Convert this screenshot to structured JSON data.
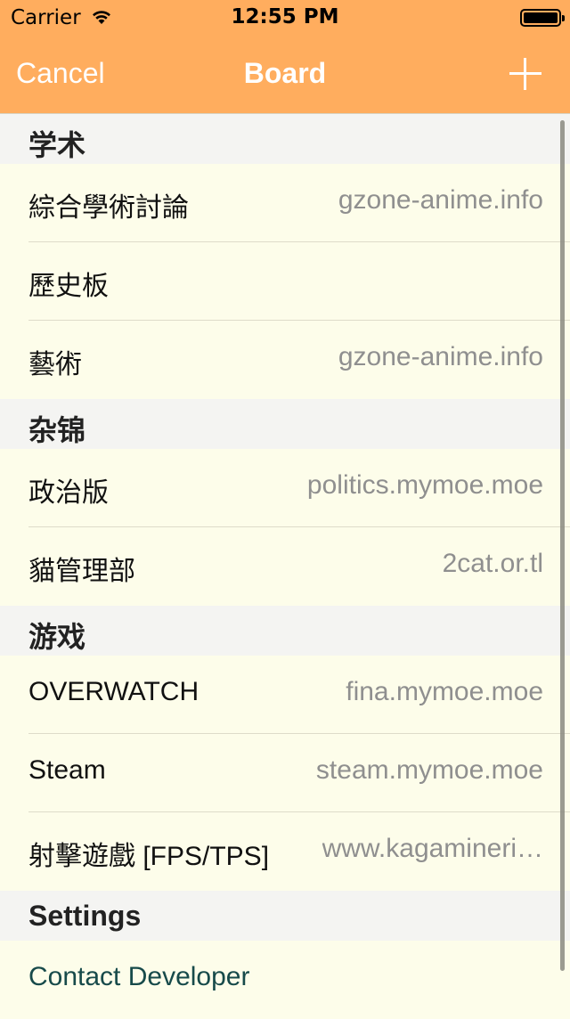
{
  "status_bar": {
    "carrier": "Carrier",
    "time": "12:55 PM"
  },
  "nav": {
    "cancel_label": "Cancel",
    "title": "Board",
    "add_icon": "plus-icon"
  },
  "sections": [
    {
      "header": "学术",
      "rows": [
        {
          "label": "綜合學術討論",
          "detail": "gzone-anime.info"
        },
        {
          "label": "歷史板",
          "detail": ""
        },
        {
          "label": "藝術",
          "detail": "gzone-anime.info"
        }
      ]
    },
    {
      "header": "杂锦",
      "rows": [
        {
          "label": "政治版",
          "detail": "politics.mymoe.moe"
        },
        {
          "label": "貓管理部",
          "detail": "2cat.or.tl"
        }
      ]
    },
    {
      "header": "游戏",
      "rows": [
        {
          "label": "OVERWATCH",
          "detail": "fina.mymoe.moe"
        },
        {
          "label": "Steam",
          "detail": "steam.mymoe.moe"
        },
        {
          "label": "射擊遊戲 [FPS/TPS]",
          "detail": "www.kagamineri…"
        }
      ]
    },
    {
      "header": "Settings",
      "rows": [
        {
          "label": "Contact Developer",
          "detail": ""
        }
      ]
    }
  ],
  "colors": {
    "nav_background": "#ffad5e",
    "list_background": "#fdfdea",
    "header_background": "#f4f4f2",
    "detail_text": "#8f8f8f",
    "action_text": "#174a4a"
  }
}
